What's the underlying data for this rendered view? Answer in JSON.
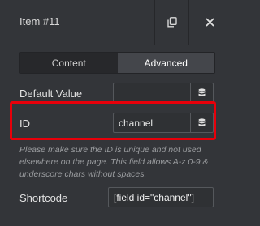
{
  "header": {
    "title": "Item #11",
    "copy_icon": "copy-icon",
    "close_icon": "close-icon"
  },
  "tabs": [
    {
      "label": "Content",
      "active": false
    },
    {
      "label": "Advanced",
      "active": true
    }
  ],
  "default_value": {
    "label": "Default Value",
    "value": "",
    "icon": "database-icon"
  },
  "id_field": {
    "label": "ID",
    "value": "channel",
    "icon": "database-icon"
  },
  "help_text": "Please make sure the ID is unique and not used elsewhere on the page. This field allows A-z 0-9 & underscore chars without spaces.",
  "shortcode": {
    "label": "Shortcode",
    "value": "[field id=\"channel\"]"
  },
  "colors": {
    "background": "#333539",
    "highlight": "#e8000a",
    "active_tab": "#44464b"
  }
}
